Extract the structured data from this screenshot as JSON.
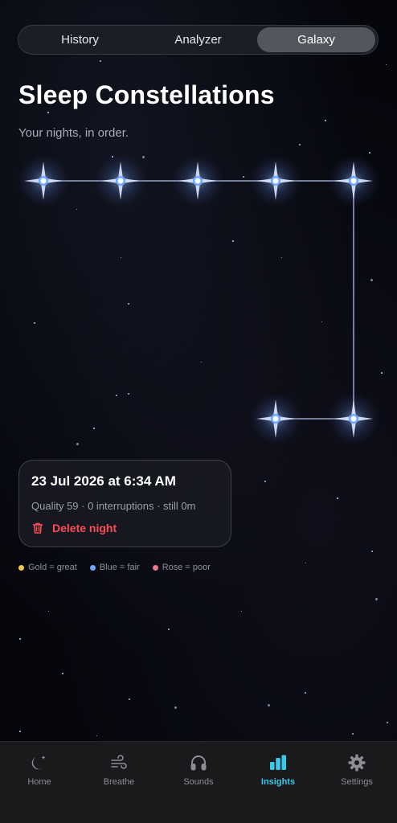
{
  "segments": [
    {
      "label": "History",
      "active": false
    },
    {
      "label": "Analyzer",
      "active": false
    },
    {
      "label": "Galaxy",
      "active": true
    }
  ],
  "page": {
    "title": "Sleep Constellations",
    "subtitle": "Your nights, in order."
  },
  "night_card": {
    "date": "23 Jul 2026 at 6:34 AM",
    "meta": "Quality 59 · 0 interruptions · still 0m",
    "delete_label": "Delete night"
  },
  "legend": [
    {
      "label": "Gold = great",
      "color": "#f2c94c"
    },
    {
      "label": "Blue = fair",
      "color": "#6fa8ff"
    },
    {
      "label": "Rose = poor",
      "color": "#e8798e"
    }
  ],
  "star_color": "#6fa8ff",
  "accent_color": "#37c8ea",
  "danger_color": "#ff4d57",
  "tabs": [
    {
      "label": "Home",
      "icon": "moon-star-icon",
      "active": false
    },
    {
      "label": "Breathe",
      "icon": "wind-icon",
      "active": false
    },
    {
      "label": "Sounds",
      "icon": "headphones-icon",
      "active": false
    },
    {
      "label": "Insights",
      "icon": "bar-chart-icon",
      "active": true
    },
    {
      "label": "Settings",
      "icon": "gear-icon",
      "active": false
    }
  ]
}
